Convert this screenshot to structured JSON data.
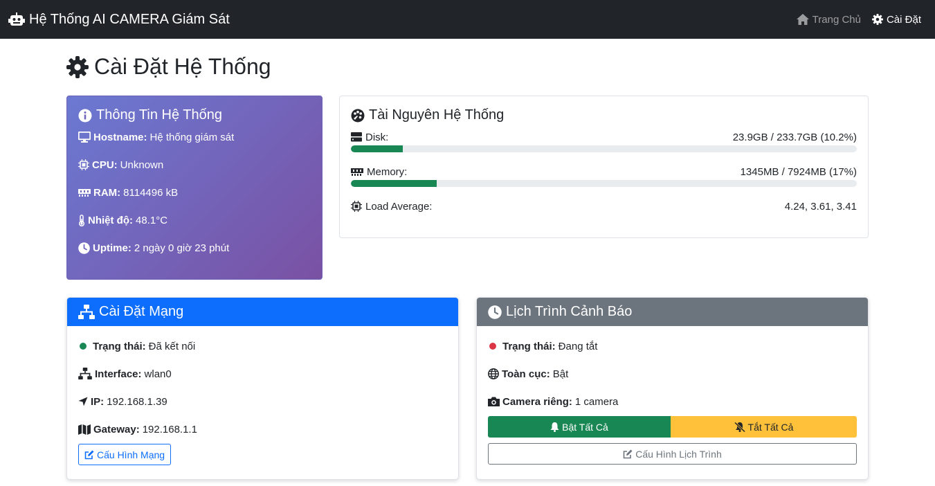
{
  "app": {
    "brand": "Hệ Thống AI CAMERA Giám Sát",
    "nav": {
      "home": "Trang Chủ",
      "settings": "Cài Đặt"
    }
  },
  "page": {
    "title": "Cài Đặt Hệ Thống"
  },
  "system_info": {
    "title": "Thông Tin Hệ Thống",
    "hostname_label": "Hostname:",
    "hostname": "Hệ thống giám sát",
    "cpu_label": "CPU:",
    "cpu": "Unknown",
    "ram_label": "RAM:",
    "ram": "8114496 kB",
    "temp_label": "Nhiệt độ:",
    "temp": "48.1°C",
    "uptime_label": "Uptime:",
    "uptime": "2 ngày 0 giờ 23 phút"
  },
  "resources": {
    "title": "Tài Nguyên Hệ Thống",
    "disk_label": "Disk:",
    "disk_value": "23.9GB / 233.7GB (10.2%)",
    "disk_percent": 10.2,
    "memory_label": "Memory:",
    "memory_value": "1345MB / 7924MB (17%)",
    "memory_percent": 17,
    "load_label": "Load Average:",
    "load_value": "4.24, 3.61, 3.41"
  },
  "network": {
    "title": "Cài Đặt Mạng",
    "status_label": "Trạng thái:",
    "status": "Đã kết nối",
    "interface_label": "Interface:",
    "interface": "wlan0",
    "ip_label": "IP:",
    "ip": "192.168.1.39",
    "gateway_label": "Gateway:",
    "gateway": "192.168.1.1",
    "config_button": "Cấu Hình Mạng"
  },
  "schedule": {
    "title": "Lịch Trình Cảnh Báo",
    "status_label": "Trạng thái:",
    "status": "Đang tắt",
    "global_label": "Toàn cục:",
    "global": "Bật",
    "camera_label": "Camera riêng:",
    "camera": "1 camera",
    "enable_all": "Bật Tất Cả",
    "disable_all": "Tắt Tất Cả",
    "config_button": "Cấu Hình Lịch Trình"
  },
  "colors": {
    "navbar": "#212529",
    "network_header": "#0d6efd",
    "schedule_header": "#6c757d",
    "success": "#198754",
    "warning": "#ffc13a",
    "status_ok": "#198754",
    "status_off": "#dc3545"
  }
}
